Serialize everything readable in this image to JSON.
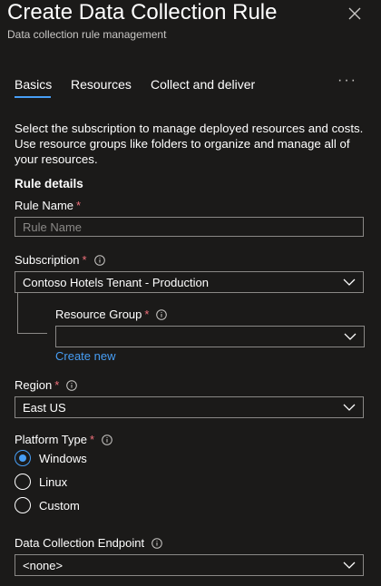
{
  "header": {
    "title": "Create Data Collection Rule",
    "subtitle": "Data collection rule management"
  },
  "tabs": [
    {
      "label": "Basics",
      "active": true
    },
    {
      "label": "Resources",
      "active": false
    },
    {
      "label": "Collect and deliver",
      "active": false
    }
  ],
  "more_label": "···",
  "description": "Select the subscription to manage deployed resources and costs. Use resource groups like folders to organize and manage all of your resources.",
  "section_title": "Rule details",
  "rule_name": {
    "label": "Rule Name",
    "required_mark": "*",
    "placeholder": "Rule Name",
    "value": ""
  },
  "subscription": {
    "label": "Subscription",
    "required_mark": "*",
    "value": "Contoso Hotels Tenant - Production"
  },
  "resource_group": {
    "label": "Resource Group",
    "required_mark": "*",
    "value": "",
    "create_new": "Create new"
  },
  "region": {
    "label": "Region",
    "required_mark": "*",
    "value": "East US"
  },
  "platform_type": {
    "label": "Platform Type",
    "required_mark": "*",
    "options": [
      {
        "label": "Windows",
        "checked": true
      },
      {
        "label": "Linux",
        "checked": false
      },
      {
        "label": "Custom",
        "checked": false
      }
    ]
  },
  "endpoint": {
    "label": "Data Collection Endpoint",
    "value": "<none>"
  },
  "colors": {
    "accent": "#479ef5",
    "required": "#f1707b",
    "background": "#1b1a19",
    "border": "#8a8886"
  }
}
